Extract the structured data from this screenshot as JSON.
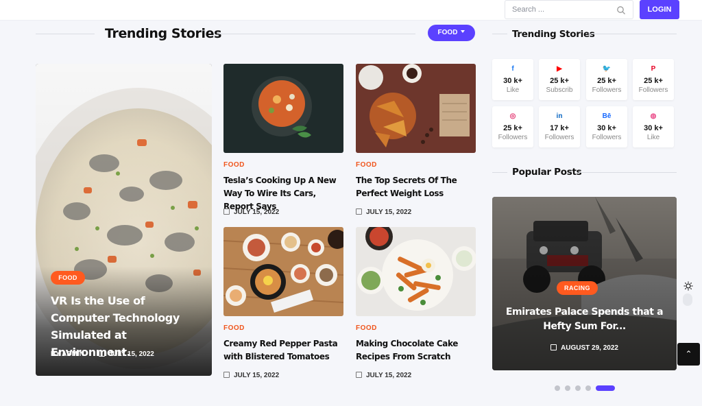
{
  "header": {
    "search_placeholder": "Search ...",
    "login_label": "LOGIN"
  },
  "trending": {
    "title": "Trending Stories",
    "filter_label": "FOOD"
  },
  "feature": {
    "category": "FOOD",
    "title": "VR Is the Use of Computer Technology Simulated at Environment.",
    "author": "BY ADMIN",
    "date": "JULY 15, 2022"
  },
  "cards": [
    {
      "category": "FOOD",
      "title": "Tesla’s Cooking Up A New Way To Wire Its Cars, Report Says",
      "date": "JULY 15, 2022"
    },
    {
      "category": "FOOD",
      "title": "The Top Secrets Of The Perfect Weight Loss",
      "date": "JULY 15, 2022"
    },
    {
      "category": "FOOD",
      "title": "Creamy Red Pepper Pasta with Blistered Tomatoes",
      "date": "JULY 15, 2022"
    },
    {
      "category": "FOOD",
      "title": "Making Chocolate Cake Recipes From Scratch",
      "date": "JULY 15, 2022"
    }
  ],
  "sidebar": {
    "trending_title": "Trending Stories",
    "social": [
      {
        "icon": "facebook-icon",
        "glyph": "f",
        "color": "#1877f2",
        "count": "30 k+",
        "label": "Like"
      },
      {
        "icon": "youtube-icon",
        "glyph": "▶",
        "color": "#ff0000",
        "count": "25 k+",
        "label": "Subscrib"
      },
      {
        "icon": "twitter-icon",
        "glyph": "🐦",
        "color": "#1da1f2",
        "count": "25 k+",
        "label": "Followers"
      },
      {
        "icon": "pinterest-icon",
        "glyph": "P",
        "color": "#e60023",
        "count": "25 k+",
        "label": "Followers"
      },
      {
        "icon": "instagram-icon",
        "glyph": "◎",
        "color": "#e1306c",
        "count": "25 k+",
        "label": "Followers"
      },
      {
        "icon": "linkedin-icon",
        "glyph": "in",
        "color": "#0a66c2",
        "count": "17 k+",
        "label": "Followers"
      },
      {
        "icon": "behance-icon",
        "glyph": "Bē",
        "color": "#1769ff",
        "count": "30 k+",
        "label": "Followers"
      },
      {
        "icon": "dribbble-icon",
        "glyph": "◍",
        "color": "#ea4c89",
        "count": "30 k+",
        "label": "Like"
      }
    ],
    "popular_title": "Popular Posts",
    "popular": {
      "category": "RACING",
      "title": "Emirates Palace Spends that a Hefty Sum For...",
      "date": "AUGUST 29, 2022"
    },
    "slider_active_index": 4,
    "slider_count": 5
  },
  "colors": {
    "accent": "#5b41ff",
    "category": "#f0551c",
    "tag_bg": "#ff5a1f"
  }
}
